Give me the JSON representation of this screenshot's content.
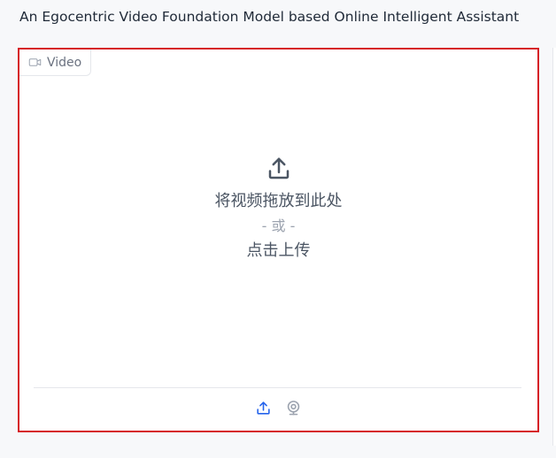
{
  "header": {
    "title": "An Egocentric Video Foundation Model based Online Intelligent Assistant"
  },
  "video_component": {
    "tab_label": "Video",
    "tab_icon": "video-camera-icon",
    "drop_text": "将视频拖放到此处",
    "or_text": "- 或 -",
    "click_text": "点击上传",
    "upload_icon": "upload-icon",
    "sources": [
      {
        "icon": "upload-icon",
        "color": "#2563eb"
      },
      {
        "icon": "webcam-icon",
        "color": "#9ca3af"
      }
    ]
  },
  "colors": {
    "highlight_border": "#d61f26",
    "accent": "#2563eb"
  }
}
